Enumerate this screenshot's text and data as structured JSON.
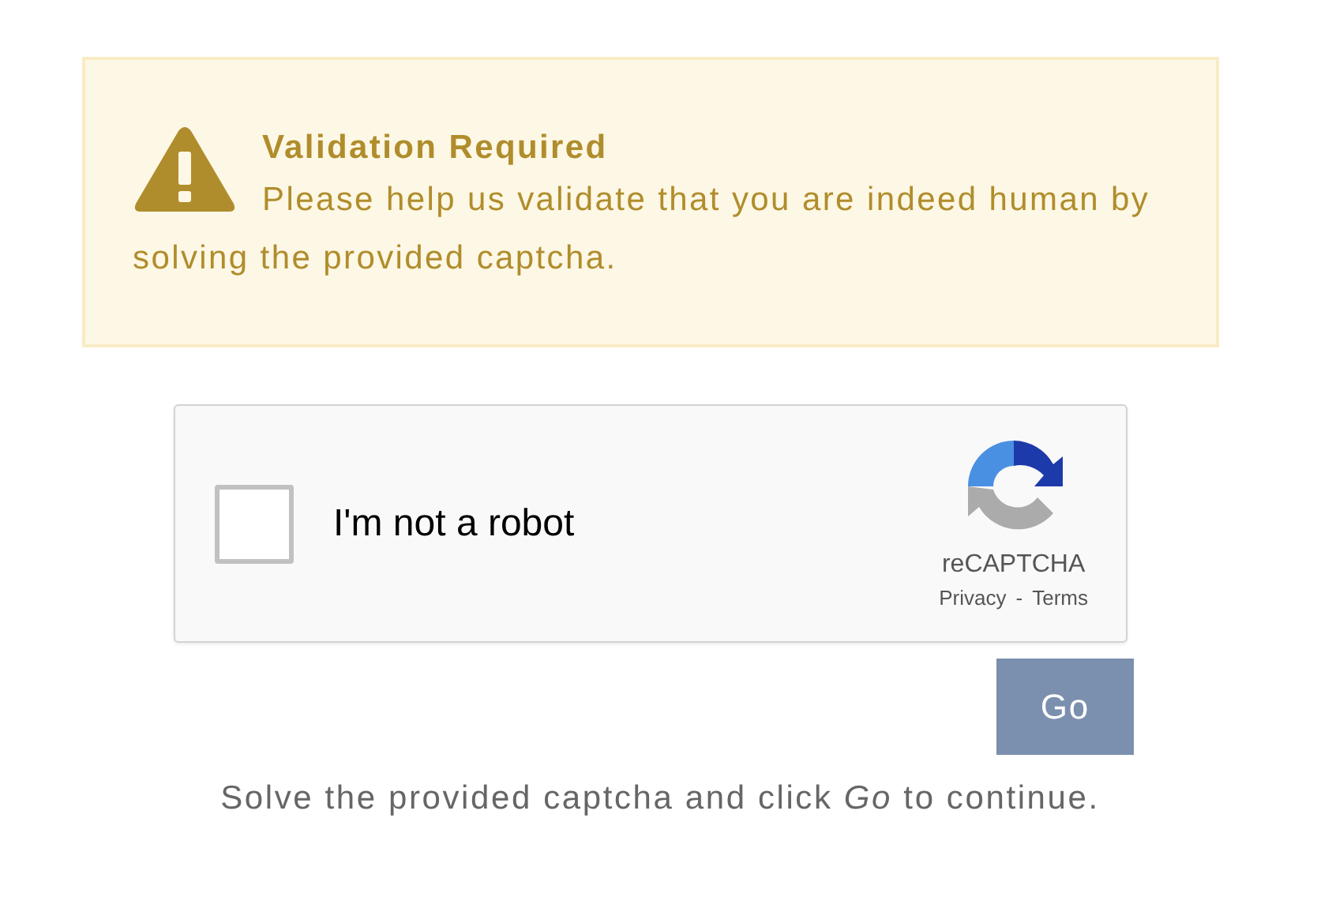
{
  "alert": {
    "title": "Validation Required",
    "message": "Please help us validate that you are indeed human by solving the provided captcha."
  },
  "captcha": {
    "checkbox": {
      "label": "I'm not a robot",
      "checked": false
    },
    "brand": "reCAPTCHA",
    "links": [
      "Privacy",
      "Terms"
    ],
    "separator": "-"
  },
  "go_button": "Go",
  "footer": "Solve the provided captcha and click *Go* to continue."
}
